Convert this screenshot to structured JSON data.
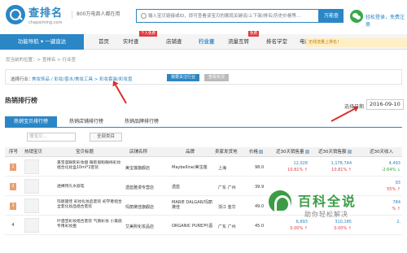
{
  "header": {
    "logo_text": "查排名",
    "logo_sub": "chapaiming.com",
    "slogan": "800万电商人都在用",
    "search_placeholder": "输入宝贝链接或ID，即可查看该宝贝的展现关键词/上下架/排名/历史价格等...",
    "search_button": "万能查",
    "login_text": "轻松登录，免费注册"
  },
  "nav": {
    "main": "功能导航 ▾ 一键直达",
    "items": [
      "首页",
      "实时查",
      "店铺查",
      "行业查",
      "流量互转",
      "排名学堂",
      "电商资讯"
    ],
    "badges": {
      "realtime": "个人免费",
      "traffic": "免费"
    },
    "ad": "无线流量上排名！"
  },
  "breadcrumb": "您当前的位置：> 查排名 > 行业查",
  "industry": {
    "label": "选择行业：",
    "path": "美妆饰品 / 彩妆/香水/美妆工具 > 彩妆套装/彩妆盘",
    "follow_button": "我要关注行业",
    "stat_button": "查看实况"
  },
  "rank": {
    "title": "热销排行榜",
    "date_label": "选择日期",
    "date_value": "2016-09-10",
    "tabs": [
      "热销宝贝排行榜",
      "热销店铺排行榜",
      "热销品牌排行榜"
    ],
    "filter_placeholder": "搜宝贝...",
    "filter_all": "全部类目"
  },
  "table": {
    "headers": [
      "序号",
      "热销宝贝",
      "宝贝标题",
      "店铺名称",
      "品牌",
      "卖家发货地",
      "价格",
      "近30天销售量",
      "近30天销售额",
      "近30天收入"
    ],
    "rows": [
      {
        "no": "1",
        "title": "美宝莲眼影彩妆盘 眼影眉粉眼线彩妆 组合化妆盒10ml*2套装",
        "shop": "美宝莲旗舰店",
        "brand": "Maybelline/美宝莲",
        "loc": "上海",
        "price": "98.0",
        "sales": "12,028",
        "sales_pct": "10.81% ↑",
        "amount": "1,178,744",
        "amount_pct": "10.81% ↑",
        "v3": "4,493",
        "v3_pct": "-2.64% ↓"
      },
      {
        "no": "2",
        "title": "透裸持久水眉笔",
        "shop": "透蓝雅漫专营店",
        "brand": "透蓝",
        "loc": "广东 广州",
        "price": "39.9",
        "sales": "",
        "sales_pct": "",
        "amount": "",
        "amount_pct": "",
        "v3": "93",
        "v3_pct": "55% ↑"
      },
      {
        "no": "3",
        "title": "玛丽黛佳 彩妆化妆品套装 初学者组合 全套化妆品组合套装",
        "shop": "玛丽黛佳旗舰店",
        "brand": "MARIE DALGAR/玛丽黛佳",
        "loc": "浙江 金华",
        "price": "49.0",
        "sales": "",
        "sales_pct": "",
        "amount": "",
        "amount_pct": "",
        "v3": "784",
        "v3_pct": "% ↑"
      },
      {
        "no": "4",
        "title": "叶酒宝彩妆组合套装 气质彩妆 小美眉专用彩妆盘",
        "shop": "艾美熙化妆品店",
        "brand": "ORGANIC PURE/叶酒",
        "loc": "广东 广州",
        "price": "45.0",
        "sales": "6,893",
        "sales_pct": "0.00% ↑",
        "amount": "310,185",
        "amount_pct": "0.00% ↑",
        "v3": "2,",
        "v3_pct": ""
      }
    ]
  },
  "watermark": {
    "title": "百科全说",
    "sub": "助你轻松解决"
  },
  "colors": {
    "accent": "#2b86c5",
    "up": "#e4393c",
    "annotation": "#d9302c"
  }
}
